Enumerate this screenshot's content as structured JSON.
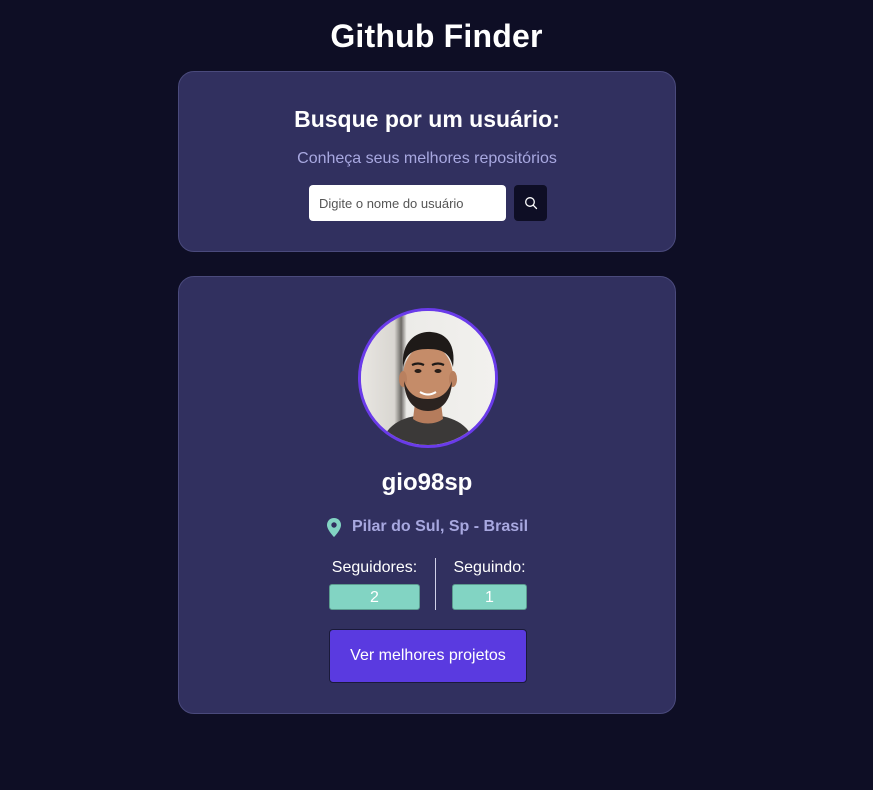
{
  "header": {
    "title": "Github Finder"
  },
  "search": {
    "heading": "Busque por um usuário:",
    "subtitle": "Conheça seus melhores repositórios",
    "placeholder": "Digite o nome do usuário",
    "value": "",
    "button_icon": "search-icon"
  },
  "profile": {
    "avatar_icon": "avatar-photo",
    "username": "gio98sp",
    "location_icon": "map-pin-icon",
    "location": "Pilar do Sul, Sp - Brasil",
    "followers_label": "Seguidores:",
    "followers_count": "2",
    "following_label": "Seguindo:",
    "following_count": "1",
    "projects_button_label": "Ver melhores projetos"
  },
  "colors": {
    "background": "#0e0e25",
    "card": "#31305f",
    "accent": "#5a3ae0",
    "avatar_ring": "#6a3bea",
    "stat_badge": "#82d4c3",
    "muted_text": "#a8a8e0"
  }
}
